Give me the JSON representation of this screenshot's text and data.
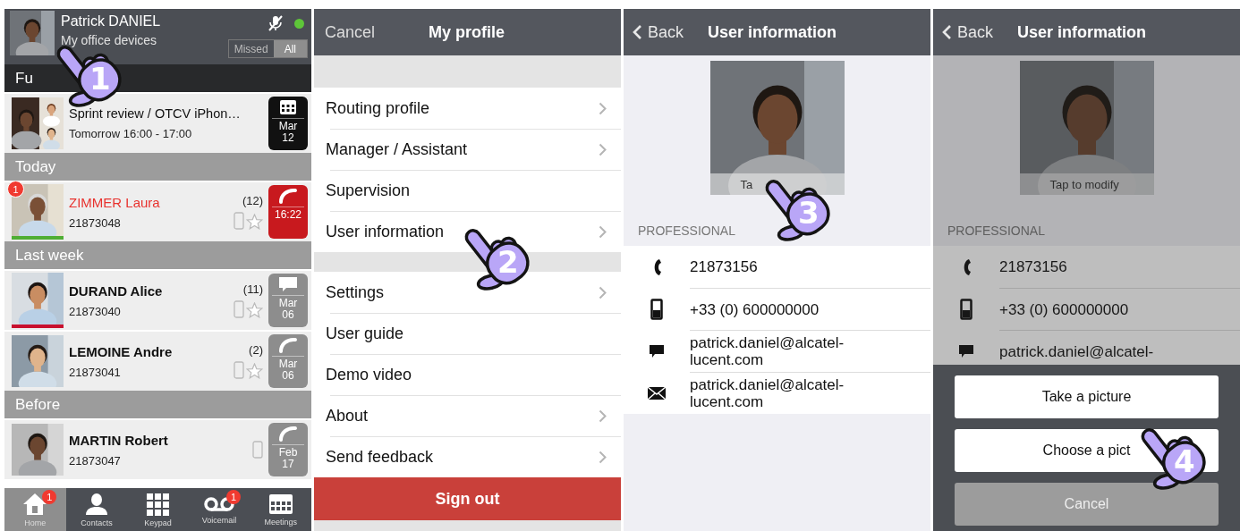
{
  "screens": [
    {
      "kind": "home",
      "pointer": {
        "step": "1"
      },
      "header": {
        "name": "Patrick DANIEL",
        "subtitle": "My office devices",
        "presence": {
          "color": "#5ec639"
        },
        "filters": [
          {
            "label": "Missed",
            "selected": false
          },
          {
            "label": "All",
            "selected": true
          }
        ]
      },
      "sections": [
        {
          "title": "Fu",
          "kind": "future",
          "items": [
            {
              "kind": "meeting",
              "title": "Sprint review / OTCV iPhon…",
              "subtitle": "Tomorrow 16:00 - 17:00",
              "tile": {
                "kind": "calendar",
                "color": "#111111",
                "lines": [
                  "Mar",
                  "12"
                ]
              }
            }
          ]
        },
        {
          "title": "Today",
          "kind": "past",
          "items": [
            {
              "kind": "call",
              "name": "ZIMMER Laura",
              "number": "21873048",
              "missed": true,
              "badge": "1",
              "color": "#4fae34",
              "count": "(12)",
              "star": true,
              "tile": {
                "kind": "call",
                "color": "#c8191e",
                "lines": [
                  "16:22"
                ]
              }
            }
          ]
        },
        {
          "title": "Last week",
          "kind": "past",
          "items": [
            {
              "kind": "call",
              "name": "DURAND Alice",
              "number": "21873040",
              "missed": false,
              "color": "#c8102e",
              "count": "(11)",
              "star": true,
              "tile": {
                "kind": "message",
                "color": "#8d8d8d",
                "lines": [
                  "Mar",
                  "06"
                ]
              }
            },
            {
              "kind": "call",
              "name": "LEMOINE Andre",
              "number": "21873041",
              "missed": false,
              "count": "(2)",
              "star": true,
              "tile": {
                "kind": "call",
                "color": "#8d8d8d",
                "lines": [
                  "Mar",
                  "06"
                ]
              }
            }
          ]
        },
        {
          "title": "Before",
          "kind": "past",
          "items": [
            {
              "kind": "call",
              "name": "MARTIN Robert",
              "number": "21873047",
              "missed": false,
              "star": false,
              "tile": {
                "kind": "call",
                "color": "#8d8d8d",
                "lines": [
                  "Feb",
                  "17"
                ]
              }
            }
          ]
        }
      ],
      "tabs": [
        {
          "kind": "home",
          "label": "Home",
          "selected": true,
          "badge": "1"
        },
        {
          "kind": "contacts",
          "label": "Contacts",
          "selected": false
        },
        {
          "kind": "keypad",
          "label": "Keypad",
          "selected": false
        },
        {
          "kind": "voicemail",
          "label": "Voicemail",
          "selected": false,
          "badge": "1"
        },
        {
          "kind": "meetings",
          "label": "Meetings",
          "selected": false
        }
      ]
    },
    {
      "kind": "menu",
      "pointer": {
        "step": "2"
      },
      "cancel": "Cancel",
      "title": "My profile",
      "groups": [
        [
          {
            "label": "Routing profile",
            "chevron": true
          },
          {
            "label": "Manager / Assistant",
            "chevron": true
          },
          {
            "label": "Supervision",
            "chevron": false
          },
          {
            "label": "User information",
            "chevron": true
          }
        ],
        [
          {
            "label": "Settings",
            "chevron": true
          },
          {
            "label": "User guide",
            "chevron": false
          },
          {
            "label": "Demo video",
            "chevron": false
          },
          {
            "label": "About",
            "chevron": true
          },
          {
            "label": "Send feedback",
            "chevron": true
          }
        ]
      ],
      "sign_out": "Sign out"
    },
    {
      "kind": "info",
      "pointer": {
        "step": "3"
      },
      "back": "Back",
      "title": "User information",
      "caption": "Ta",
      "section": "PROFESSIONAL",
      "dimmed": false,
      "rows": [
        {
          "kind": "phone",
          "lines": [
            "21873156"
          ]
        },
        {
          "kind": "mobile",
          "lines": [
            "+33 (0) 600000000"
          ]
        },
        {
          "kind": "chat",
          "lines": [
            "patrick.daniel@alcatel-",
            "lucent.com"
          ]
        },
        {
          "kind": "email",
          "lines": [
            "patrick.daniel@alcatel-",
            "lucent.com"
          ]
        }
      ]
    },
    {
      "kind": "info",
      "pointer": {
        "step": "4"
      },
      "back": "Back",
      "title": "User information",
      "caption": "Tap to modify",
      "section": "PROFESSIONAL",
      "dimmed": true,
      "rows": [
        {
          "kind": "phone",
          "lines": [
            "21873156"
          ]
        },
        {
          "kind": "mobile",
          "lines": [
            "+33 (0) 600000000"
          ]
        },
        {
          "kind": "chat",
          "lines": [
            "patrick.daniel@alcatel-"
          ]
        }
      ],
      "sheet": [
        {
          "kind": "default",
          "label": "Take a picture"
        },
        {
          "kind": "default",
          "label": "Choose a pict"
        },
        {
          "kind": "cancel",
          "label": "Cancel"
        }
      ]
    }
  ]
}
